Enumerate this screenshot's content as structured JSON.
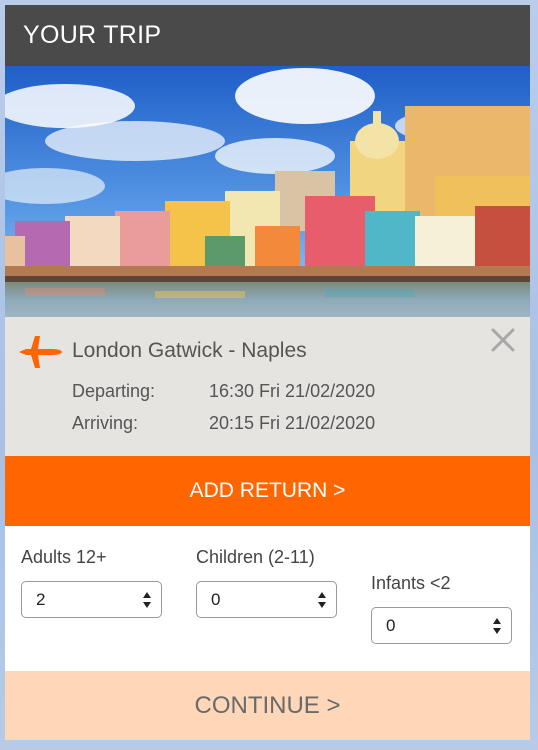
{
  "header": {
    "title": "YOUR TRIP"
  },
  "flight": {
    "route": "London Gatwick - Naples",
    "departing_label": "Departing:",
    "departing_value": "16:30 Fri 21/02/2020",
    "arriving_label": "Arriving:",
    "arriving_value": "20:15 Fri 21/02/2020",
    "icon": "plane-icon",
    "close_icon": "close-icon"
  },
  "add_return": {
    "label": "ADD RETURN >"
  },
  "passengers": {
    "adults": {
      "label": "Adults 12+",
      "value": "2"
    },
    "children": {
      "label": "Children (2-11)",
      "value": "0"
    },
    "infants": {
      "label": "Infants <2",
      "value": "0"
    }
  },
  "continue": {
    "label": "CONTINUE >"
  },
  "colors": {
    "accent": "#ff6600",
    "header_bg": "#4a4a4a",
    "continue_bg": "#fdd7b8",
    "flight_bg": "#e6e4e1"
  }
}
